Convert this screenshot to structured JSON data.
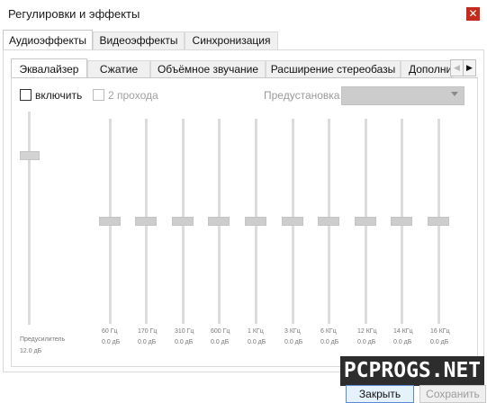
{
  "window": {
    "title": "Регулировки и эффекты",
    "close_symbol": "✕"
  },
  "outer_tabs": [
    {
      "label": "Аудиоэффекты",
      "active": true
    },
    {
      "label": "Видеоэффекты",
      "active": false
    },
    {
      "label": "Синхронизация",
      "active": false
    }
  ],
  "inner_tabs": [
    {
      "label": "Эквалайзер",
      "active": true
    },
    {
      "label": "Сжатие",
      "active": false
    },
    {
      "label": "Объёмное звучание",
      "active": false
    },
    {
      "label": "Расширение стереобазы",
      "active": false
    },
    {
      "label": "Дополнительно",
      "active": false
    }
  ],
  "tab_scroll": {
    "left_symbol": "◀",
    "right_symbol": "▶"
  },
  "equalizer": {
    "enable_label": "включить",
    "enable_checked": false,
    "two_pass_label": "2 прохода",
    "two_pass_checked": false,
    "preset_label": "Предустановка",
    "preset_value": "",
    "preamp": {
      "label": "Предусилитель",
      "value_label": "12.0 дБ",
      "level_fraction": 0.9
    },
    "bands": [
      {
        "freq": "60 Гц",
        "value": "0.0 дБ",
        "level_fraction": 0.5
      },
      {
        "freq": "170 Гц",
        "value": "0.0 дБ",
        "level_fraction": 0.5
      },
      {
        "freq": "310 Гц",
        "value": "0.0 дБ",
        "level_fraction": 0.5
      },
      {
        "freq": "600 Гц",
        "value": "0.0 дБ",
        "level_fraction": 0.5
      },
      {
        "freq": "1 КГц",
        "value": "0.0 дБ",
        "level_fraction": 0.5
      },
      {
        "freq": "3 КГц",
        "value": "0.0 дБ",
        "level_fraction": 0.5
      },
      {
        "freq": "6 КГц",
        "value": "0.0 дБ",
        "level_fraction": 0.5
      },
      {
        "freq": "12 КГц",
        "value": "0.0 дБ",
        "level_fraction": 0.5
      },
      {
        "freq": "14 КГц",
        "value": "0.0 дБ",
        "level_fraction": 0.5
      },
      {
        "freq": "16 КГц",
        "value": "0.0 дБ",
        "level_fraction": 0.5
      }
    ]
  },
  "watermark": "PCPROGS.NET",
  "buttons": {
    "close": "Закрыть",
    "save": "Сохранить"
  },
  "colors": {
    "close_accent": "#c42b1c",
    "focus_border": "#5a8ad6"
  }
}
